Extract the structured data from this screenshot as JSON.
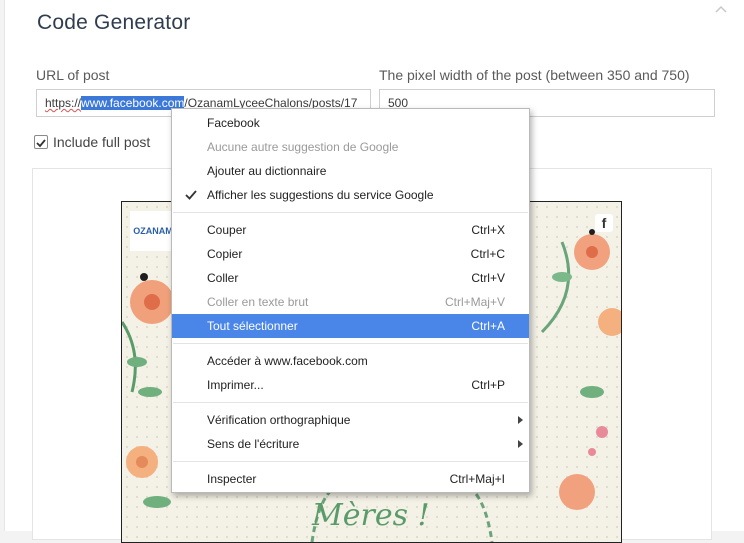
{
  "page": {
    "title": "Code Generator"
  },
  "form": {
    "url_label": "URL of post",
    "url_prefix": "https://",
    "url_selected": "www.facebook.com",
    "url_rest": "/OzanamLyceeChalons/posts/17",
    "width_label": "The pixel width of the post (between 350 and 750)",
    "width_value": "500",
    "include_full_post_label": "Include full post",
    "include_full_post_checked": true
  },
  "preview": {
    "logo_text": "OZANAM",
    "social_icon": "facebook-icon",
    "script_text": "Mères !"
  },
  "context_menu": {
    "items": [
      {
        "label": "Facebook",
        "shortcut": "",
        "disabled": false
      },
      {
        "label": "Aucune autre suggestion de Google",
        "shortcut": "",
        "disabled": true
      },
      {
        "label": "Ajouter au dictionnaire",
        "shortcut": "",
        "disabled": false
      },
      {
        "label": "Afficher les suggestions du service Google",
        "shortcut": "",
        "checked": true
      },
      {
        "label": "Couper",
        "shortcut": "Ctrl+X"
      },
      {
        "label": "Copier",
        "shortcut": "Ctrl+C"
      },
      {
        "label": "Coller",
        "shortcut": "Ctrl+V"
      },
      {
        "label": "Coller en texte brut",
        "shortcut": "Ctrl+Maj+V",
        "disabled": true
      },
      {
        "label": "Tout sélectionner",
        "shortcut": "Ctrl+A",
        "highlighted": true
      },
      {
        "label": "Accéder à www.facebook.com",
        "shortcut": ""
      },
      {
        "label": "Imprimer...",
        "shortcut": "Ctrl+P"
      },
      {
        "label": "Vérification orthographique",
        "submenu": true
      },
      {
        "label": "Sens de l'écriture",
        "submenu": true
      },
      {
        "label": "Inspecter",
        "shortcut": "Ctrl+Maj+I"
      }
    ]
  },
  "colors": {
    "title": "#2f3d4f",
    "menu_highlight": "#4a85e8",
    "selection": "#3b78d8"
  }
}
